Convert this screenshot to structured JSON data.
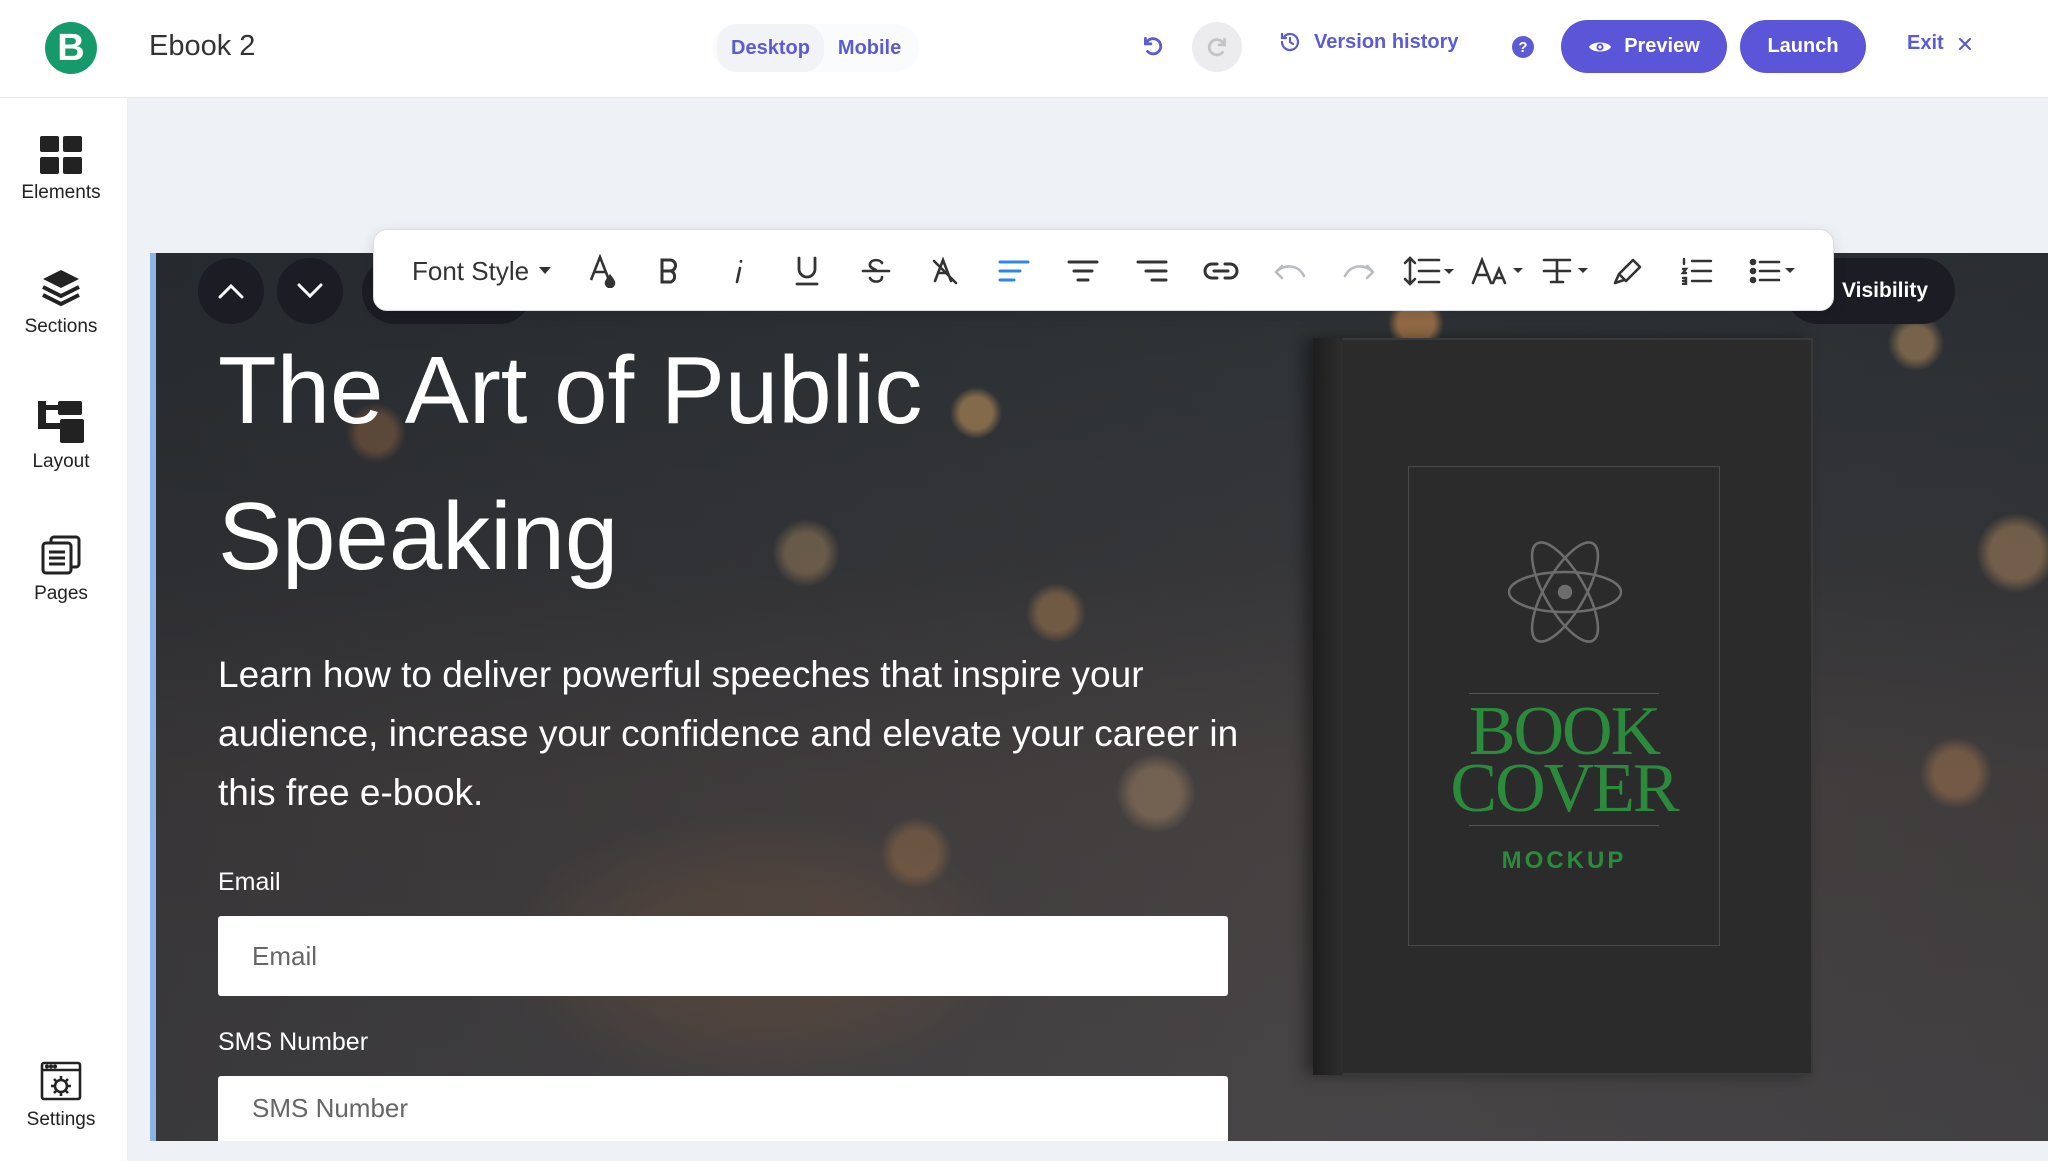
{
  "app": {
    "logo_letter": "B",
    "doc_title": "Ebook 2"
  },
  "header": {
    "device_options": [
      "Desktop",
      "Mobile"
    ],
    "version_history_label": "Version history",
    "help_label": "?",
    "preview_label": "Preview",
    "launch_label": "Launch",
    "exit_label": "Exit"
  },
  "sidebar": {
    "items": [
      {
        "label": "Elements",
        "icon": "grid-icon"
      },
      {
        "label": "Sections",
        "icon": "layers-icon"
      },
      {
        "label": "Layout",
        "icon": "layout-tree-icon"
      },
      {
        "label": "Pages",
        "icon": "pages-icon"
      },
      {
        "label": "Settings",
        "icon": "settings-window-icon"
      }
    ]
  },
  "toolbar": {
    "font_style_label": "Font Style",
    "tools": [
      "text-color-icon",
      "bold-icon",
      "italic-icon",
      "underline-icon",
      "strikethrough-icon",
      "clear-format-icon",
      "align-left-icon",
      "align-center-icon",
      "align-right-icon",
      "link-icon",
      "undo-icon",
      "redo-icon",
      "line-height-icon",
      "font-size-icon",
      "text-spacing-icon",
      "highlighter-icon",
      "ordered-list-icon",
      "unordered-list-icon"
    ],
    "active_color": "#2f86e9"
  },
  "section_controls": {
    "visibility_label": "Visibility"
  },
  "hero": {
    "title_line1": "The Art of Public",
    "title_line2": "Speaking",
    "subtitle": "Learn how to deliver powerful speeches that inspire your audience, increase your confidence and elevate your career in this free e-book.",
    "email_label": "Email",
    "email_placeholder": "Email",
    "sms_label": "SMS Number",
    "sms_placeholder": "SMS Number"
  },
  "book": {
    "line1": "BOOK",
    "line2": "COVER",
    "line3": "MOCKUP"
  },
  "colors": {
    "brand_purple": "#5b55d8",
    "logo_green": "#179a6b",
    "book_green": "#2c8a3c"
  }
}
